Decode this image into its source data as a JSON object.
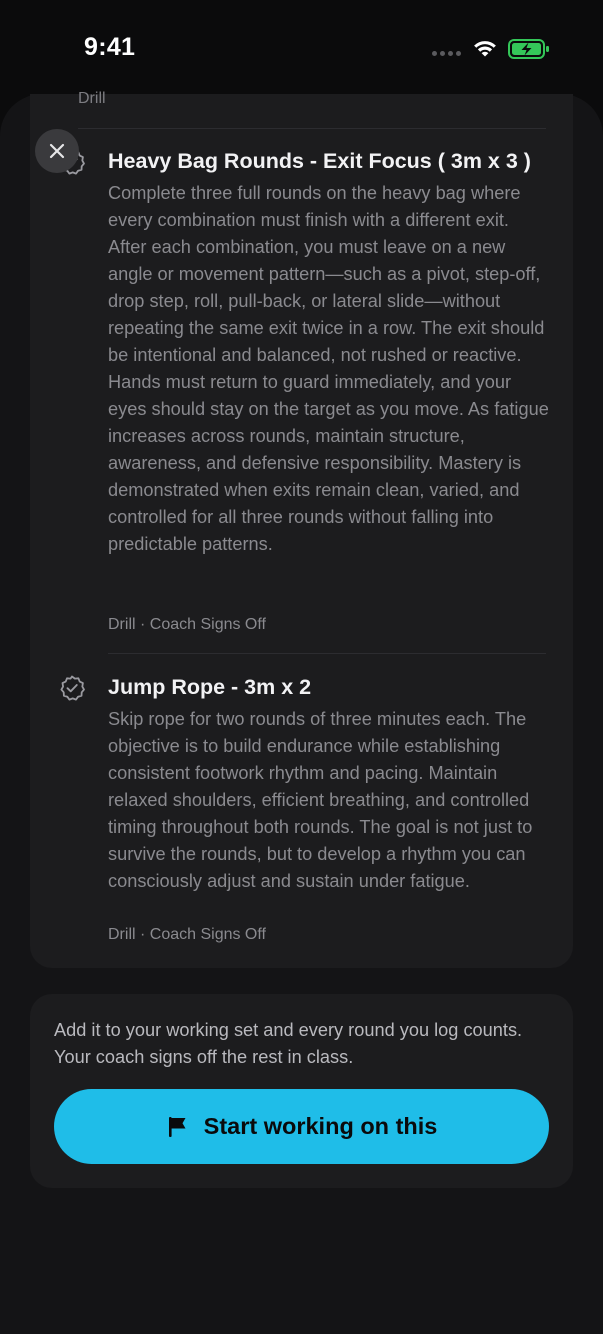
{
  "status_bar": {
    "time": "9:41"
  },
  "previous_item": {
    "meta": "Drill"
  },
  "drills": [
    {
      "title": "Heavy Bag Rounds - Exit Focus ( 3m x 3 )",
      "description": "Complete three full rounds on the heavy bag where every combination must finish with a different exit. After each combination, you must leave on a new angle or movement pattern—such as a pivot, step-off, drop step, roll, pull-back, or lateral slide—without repeating the same exit twice in a row. The exit should be intentional and balanced, not rushed or reactive. Hands must return to guard immediately, and your eyes should stay on the target as you move. As fatigue increases across rounds, maintain structure, awareness, and defensive responsibility. Mastery is demonstrated when exits remain clean, varied, and controlled for all three rounds without falling into predictable patterns.",
      "meta": "Drill · Coach Signs Off",
      "icon": "verified-badge-icon"
    },
    {
      "title": "Jump Rope - 3m x 2",
      "description": "Skip rope for two rounds of three minutes each. The objective is to build endurance while establishing consistent footwork rhythm and pacing. Maintain relaxed shoulders, efficient breathing, and controlled timing throughout both rounds. The goal is not just to survive the rounds, but to develop a rhythm you can consciously adjust and sustain under fatigue.",
      "meta": "Drill · Coach Signs Off",
      "icon": "verified-badge-icon"
    }
  ],
  "cta": {
    "text": "Add it to your working set and every round you log counts. Your coach signs off the rest in class.",
    "button_label": "Start working on this",
    "button_icon": "flag-icon"
  },
  "colors": {
    "accent": "#1fbde8",
    "battery": "#34c759"
  }
}
